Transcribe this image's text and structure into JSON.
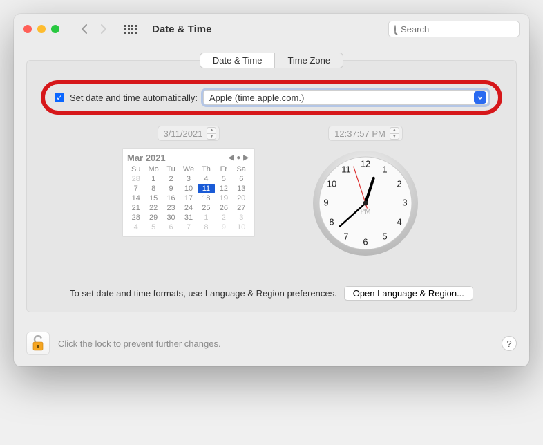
{
  "header": {
    "title": "Date & Time",
    "search_placeholder": "Search"
  },
  "tabs": {
    "date_time": "Date & Time",
    "time_zone": "Time Zone"
  },
  "auto": {
    "checked": true,
    "label": "Set date and time automatically:",
    "server": "Apple (time.apple.com.)"
  },
  "date_field": "3/11/2021",
  "time_field": "12:37:57 PM",
  "calendar": {
    "month_label": "Mar 2021",
    "dow": [
      "Su",
      "Mo",
      "Tu",
      "We",
      "Th",
      "Fr",
      "Sa"
    ],
    "leading": [
      "28"
    ],
    "days": [
      "1",
      "2",
      "3",
      "4",
      "5",
      "6",
      "7",
      "8",
      "9",
      "10",
      "11",
      "12",
      "13",
      "14",
      "15",
      "16",
      "17",
      "18",
      "19",
      "20",
      "21",
      "22",
      "23",
      "24",
      "25",
      "26",
      "27",
      "28",
      "29",
      "30",
      "31"
    ],
    "trailing": [
      "1",
      "2",
      "3",
      "4",
      "5",
      "6",
      "7",
      "8",
      "9",
      "10"
    ],
    "selected": "11"
  },
  "clock": {
    "ampm": "PM"
  },
  "note": "To set date and time formats, use Language & Region preferences.",
  "open_lang_btn": "Open Language & Region...",
  "lock_text": "Click the lock to prevent further changes.",
  "help": "?"
}
